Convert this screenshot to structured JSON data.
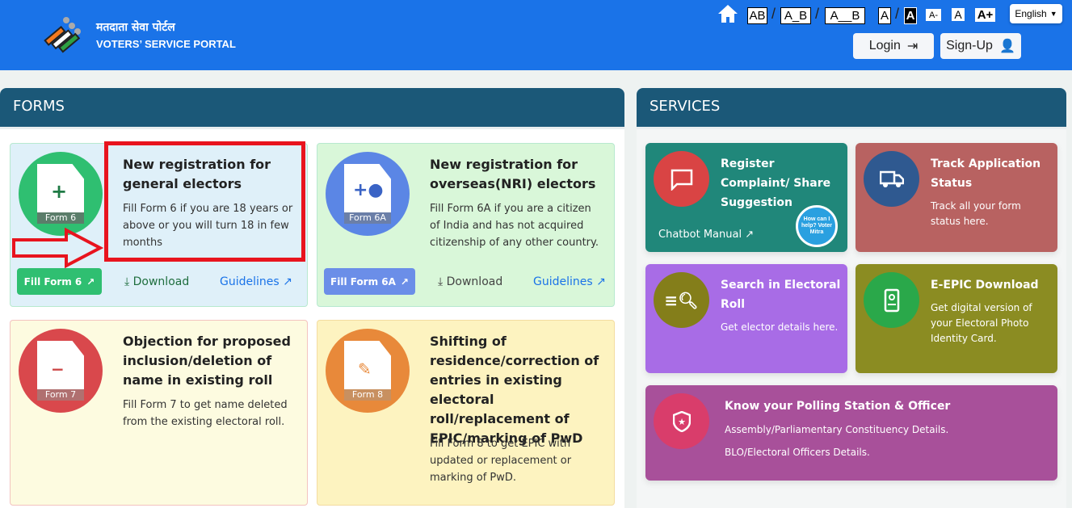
{
  "header": {
    "title_hindi": "मतदाता सेवा पोर्टल",
    "title_en": "VOTERS’ SERVICE PORTAL",
    "spacing": [
      "AB",
      "A_B",
      "A__B"
    ],
    "contrast": [
      "A",
      "A"
    ],
    "font_sizes": [
      "A-",
      "A",
      "A+"
    ],
    "language": "English",
    "login": "Login",
    "signup": "Sign-Up"
  },
  "forms": {
    "heading": "FORMS",
    "cards": [
      {
        "label": "Form 6",
        "title": "New registration for general electors",
        "desc": "Fill Form 6 if you are 18 years or above or you will turn 18 in few months",
        "fill": "Fill Form 6",
        "download": "Download",
        "guidelines": "Guidelines"
      },
      {
        "label": "Form 6A",
        "title": "New registration for overseas(NRI) electors",
        "desc": "Fill Form 6A if you are a citizen of India and has not acquired citizenship of any other country.",
        "fill": "Fill Form 6A",
        "download": "Download",
        "guidelines": "Guidelines"
      },
      {
        "label": "Form 7",
        "title": "Objection for proposed inclusion/deletion of name in existing roll",
        "desc": "Fill Form 7 to get name deleted from the existing electoral roll."
      },
      {
        "label": "Form 8",
        "title": "Shifting of residence/correction of entries in existing electoral roll/replacement of EPIC/marking of PwD",
        "desc": "Fill Form 8 to get EPIC with updated or replacement or marking of PwD."
      }
    ]
  },
  "services": {
    "heading": "SERVICES",
    "cards": [
      {
        "title": "Register Complaint/ Share Suggestion",
        "link": "Chatbot Manual",
        "badge": "How can I help? Voter Mitra",
        "color": "#20877a"
      },
      {
        "title": "Track Application Status",
        "desc": "Track all your form status here.",
        "color": "#b86261"
      },
      {
        "title": "Search in Electoral Roll",
        "desc": "Get elector details here.",
        "color": "#a86ce6"
      },
      {
        "title": "E-EPIC Download",
        "desc": "Get digital version of your Electoral Photo Identity Card.",
        "color": "#8b8c22"
      },
      {
        "title": "Know your Polling Station & Officer",
        "desc1": "Assembly/Parliamentary Constituency Details.",
        "desc2": "BLO/Electoral Officers Details.",
        "color": "#a8509a"
      }
    ]
  }
}
